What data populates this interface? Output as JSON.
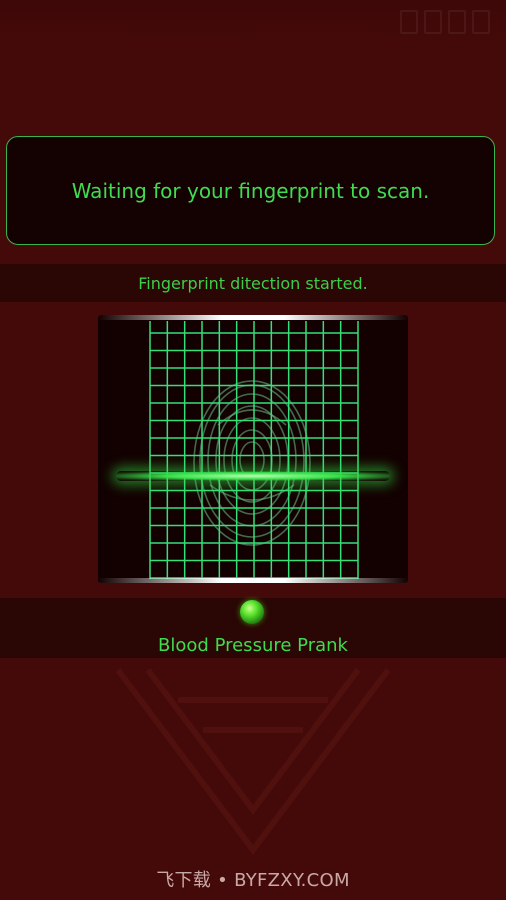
{
  "message_panel": {
    "text": "Waiting for your fingerprint to scan."
  },
  "status_strip": {
    "text": "Fingerprint ditection started."
  },
  "scanner": {
    "icon": "fingerprint-icon",
    "accent_color": "#34d35a"
  },
  "indicator": {
    "icon": "status-led-icon",
    "color": "#55e02a"
  },
  "app": {
    "title": "Blood Pressure Prank"
  },
  "watermark": {
    "text": "飞下载 • BYFZXY.COM"
  },
  "colors": {
    "background": "#440a09",
    "accent": "#3fdc4f",
    "panel": "#140202"
  }
}
